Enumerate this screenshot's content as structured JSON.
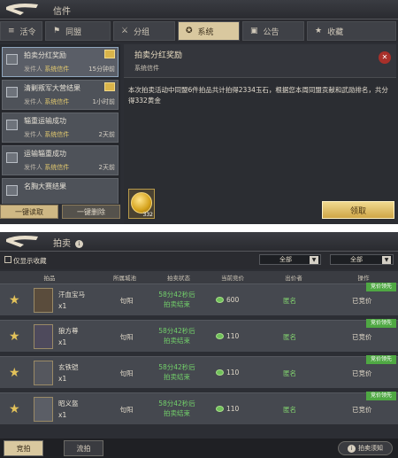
{
  "mail": {
    "title": "信件",
    "tabs": [
      {
        "icon": "≡",
        "label": "活令"
      },
      {
        "icon": "⚑",
        "label": "同盟"
      },
      {
        "icon": "⚔",
        "label": "分组"
      },
      {
        "icon": "✪",
        "label": "系统"
      },
      {
        "icon": "▣",
        "label": "公告"
      },
      {
        "icon": "★",
        "label": "收藏"
      }
    ],
    "list": [
      {
        "subject": "拍卖分红奖励",
        "sender_prefix": "发件人",
        "sender": "系统信件",
        "time": "15分钟前"
      },
      {
        "subject": "清剿叛军大营结果",
        "sender_prefix": "发件人",
        "sender": "系统信件",
        "time": "1小时前"
      },
      {
        "subject": "辎重运输成功",
        "sender_prefix": "发件人",
        "sender": "系统信件",
        "time": "2天前"
      },
      {
        "subject": "运输辎重成功",
        "sender_prefix": "发件人",
        "sender": "系统信件",
        "time": "2天前"
      },
      {
        "subject": "名胸大赛结果",
        "sender_prefix": "",
        "sender": "",
        "time": ""
      }
    ],
    "btn_read_all": "一键读取",
    "btn_delete_all": "一键删除",
    "detail": {
      "title": "拍卖分红奖励",
      "sender": "系统信件",
      "body": "本次拍卖活动中同盟6件拍品共计拍得2334玉石，根据您本周同盟贡献和武勋排名，共分得332黄金",
      "attachment_count": "332",
      "claim_label": "领取"
    }
  },
  "auction": {
    "title": "拍卖",
    "filter_label": "仅显示收藏",
    "dropdown1": "全部",
    "dropdown2": "全部",
    "columns": [
      "拍品",
      "所属城池",
      "拍卖状态",
      "当前竞价",
      "出价者",
      "操作"
    ],
    "rows": [
      {
        "name": "汗血宝马",
        "qty": "x1",
        "city": "句阳",
        "state1": "58分42秒后",
        "state2": "拍卖结束",
        "price": "600",
        "bidder": "匿名",
        "op": "已竞价",
        "lead": "竞价领先"
      },
      {
        "name": "狼方尊",
        "qty": "x1",
        "city": "句阳",
        "state1": "58分42秒后",
        "state2": "拍卖结束",
        "price": "110",
        "bidder": "匿名",
        "op": "已竞价",
        "lead": "竞价领先"
      },
      {
        "name": "玄铁铠",
        "qty": "x1",
        "city": "句阳",
        "state1": "58分42秒后",
        "state2": "拍卖结束",
        "price": "110",
        "bidder": "匿名",
        "op": "已竞价",
        "lead": "竞价领先"
      },
      {
        "name": "昭义盔",
        "qty": "x1",
        "city": "句阳",
        "state1": "58分42秒后",
        "state2": "拍卖结束",
        "price": "110",
        "bidder": "匿名",
        "op": "已竞价",
        "lead": "竞价领先"
      }
    ],
    "bottom_tabs": [
      "竞拍",
      "流拍"
    ],
    "notice_label": "拍卖须知"
  }
}
